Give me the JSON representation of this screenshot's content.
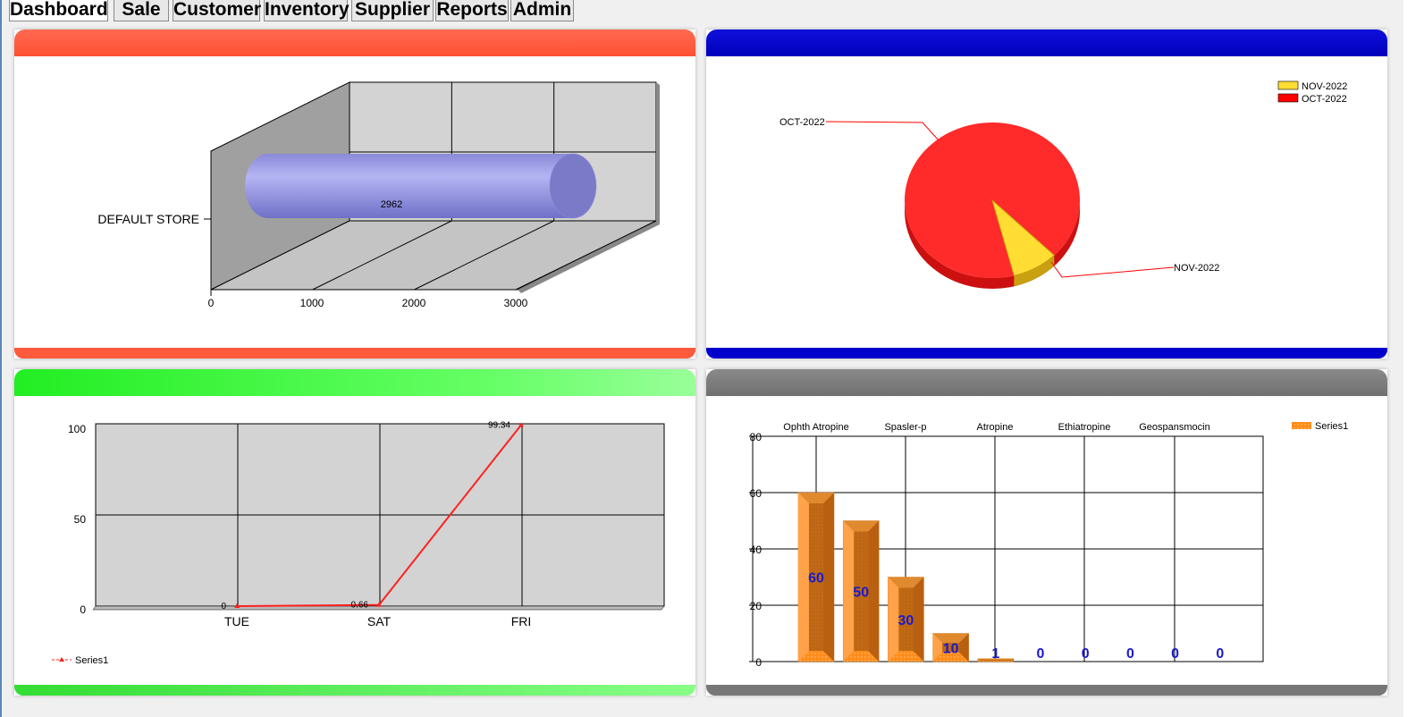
{
  "tabs": [
    {
      "label": "Dashboard",
      "active": true
    },
    {
      "label": "Sale",
      "active": false
    },
    {
      "label": "Customer",
      "active": false
    },
    {
      "label": "Inventory",
      "active": false
    },
    {
      "label": "Supplier",
      "active": false
    },
    {
      "label": "Reports",
      "active": false
    },
    {
      "label": "Admin",
      "active": false
    }
  ],
  "panels": {
    "store_stock": {
      "header_color": "#ff5a3c",
      "chart_data": {
        "type": "bar",
        "orientation": "horizontal",
        "categories": [
          "DEFAULT STORE"
        ],
        "values": [
          2962
        ],
        "data_labels": [
          "2962"
        ],
        "xlim": [
          0,
          3000
        ],
        "xticks": [
          "0",
          "1000",
          "2000",
          "3000"
        ],
        "style": "3d-cylinder",
        "bar_color": "#9999ee",
        "grid": true
      }
    },
    "monthly_sales": {
      "header_color": "#0000cc",
      "chart_data": {
        "type": "pie",
        "style": "3d",
        "slices": [
          {
            "label": "OCT-2022",
            "value": 91.5,
            "color": "#ff2a2a"
          },
          {
            "label": "NOV-2022",
            "value": 8.5,
            "color": "#ffdd33"
          }
        ],
        "legend": [
          "NOV-2022",
          "OCT-2022"
        ],
        "legend_colors": [
          "#ffdd33",
          "#ff0000"
        ],
        "legend_position": "top-right"
      }
    },
    "weekday_sales": {
      "header_color": "#2ee82e",
      "chart_data": {
        "type": "line",
        "categories": [
          "TUE",
          "SAT",
          "FRI"
        ],
        "series": [
          {
            "name": "Series1",
            "values": [
              0,
              0.66,
              99.34
            ],
            "labels": [
              "0",
              "0.66",
              "99.34"
            ],
            "color": "#ff2020"
          }
        ],
        "ylim": [
          0,
          100
        ],
        "yticks": [
          "0",
          "50",
          "100"
        ],
        "legend_position": "bottom-left",
        "grid": true
      }
    },
    "top_products": {
      "header_color": "#7a7a7a",
      "chart_data": {
        "type": "bar",
        "categories": [
          "Ophth Atropine",
          "Spasler-p",
          "Atropine",
          "Ethiatropine",
          "Geospansmocin"
        ],
        "series": [
          {
            "name": "Series1",
            "values": [
              60,
              50,
              30,
              10,
              1,
              0,
              0,
              0,
              0,
              0
            ],
            "labels": [
              "60",
              "50",
              "30",
              "10",
              "1",
              "0",
              "0",
              "0",
              "0",
              "0"
            ],
            "color": "#ff8c1a"
          }
        ],
        "ylim": [
          0,
          80
        ],
        "yticks": [
          "0",
          "20",
          "40",
          "60",
          "80"
        ],
        "legend_position": "top-right",
        "label_color": "#1a1acc",
        "grid": true
      }
    }
  }
}
